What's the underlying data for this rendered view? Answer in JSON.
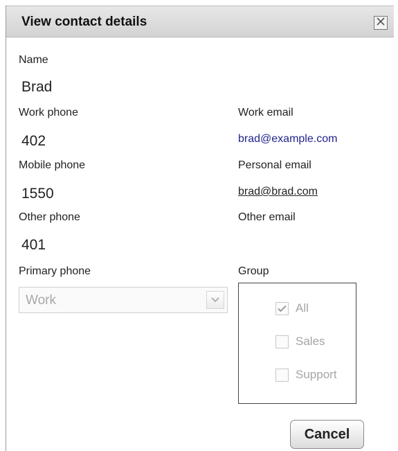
{
  "dialog": {
    "title": "View contact details",
    "close_icon": "close-icon"
  },
  "fields": {
    "name_label": "Name",
    "name_value": "Brad",
    "work_phone_label": "Work phone",
    "work_phone_value": "402",
    "work_email_label": "Work email",
    "work_email_value": "brad@example.com",
    "mobile_phone_label": "Mobile phone",
    "mobile_phone_value": "1550",
    "personal_email_label": "Personal email",
    "personal_email_value": "brad@brad.com",
    "other_phone_label": "Other phone",
    "other_phone_value": "401",
    "other_email_label": "Other email",
    "other_email_value": ""
  },
  "primary_phone": {
    "label": "Primary phone",
    "selected": "Work"
  },
  "group": {
    "label": "Group",
    "options": [
      {
        "label": "All",
        "checked": true
      },
      {
        "label": "Sales",
        "checked": false
      },
      {
        "label": "Support",
        "checked": false
      }
    ]
  },
  "actions": {
    "cancel_label": "Cancel"
  },
  "colors": {
    "email_link": "#22238c",
    "disabled_text": "#a5a5a5",
    "titlebar": "#dcdcdc"
  }
}
